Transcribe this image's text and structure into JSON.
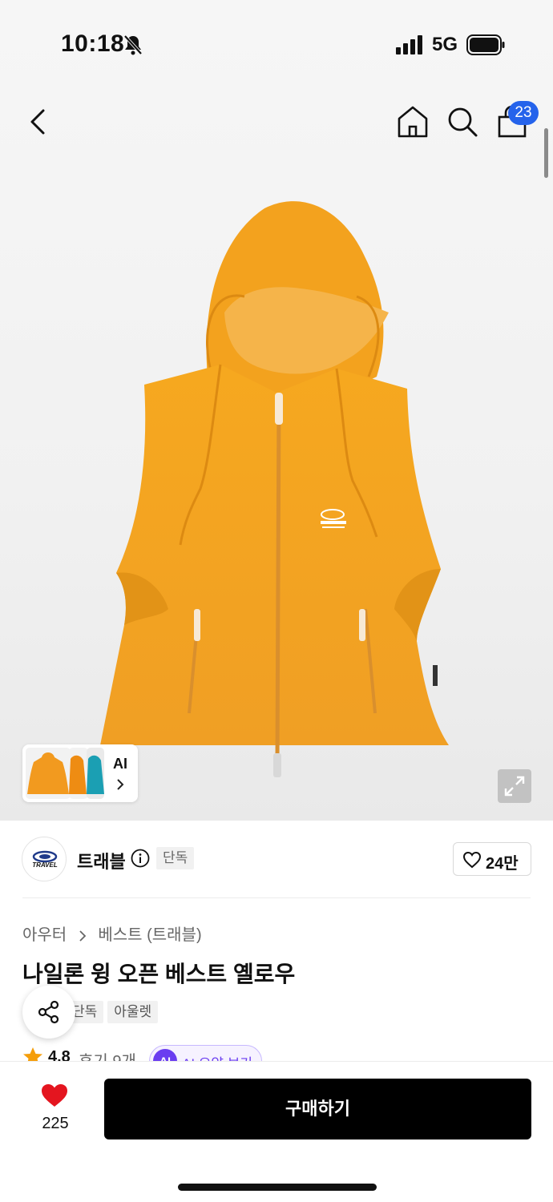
{
  "status_bar": {
    "time": "10:18",
    "network": "5G"
  },
  "nav": {
    "cart_count": "23"
  },
  "gallery": {
    "thumb_label": "AI"
  },
  "brand": {
    "name": "트래블",
    "exclusive_tag": "단독",
    "like_count": "24만",
    "logo_text": "TRAVEL"
  },
  "product": {
    "breadcrumb": [
      "아우터",
      "베스트 (트래블)"
    ],
    "title": "나일론 윙 오픈 베스트 옐로우",
    "tags": [
      "단독",
      "아울렛"
    ],
    "rating": "4.8",
    "reviews": "후기 9개",
    "ai_summary": "AI 요약 보기",
    "ai_badge": "AI"
  },
  "bottom": {
    "wish_count": "225",
    "buy_label": "구매하기"
  },
  "colors": {
    "accent_blue": "#2563eb",
    "heart_red": "#e4151f",
    "star_orange": "#f59e0b",
    "ai_purple": "#6a3df0",
    "product_orange": "#f2a22a"
  }
}
